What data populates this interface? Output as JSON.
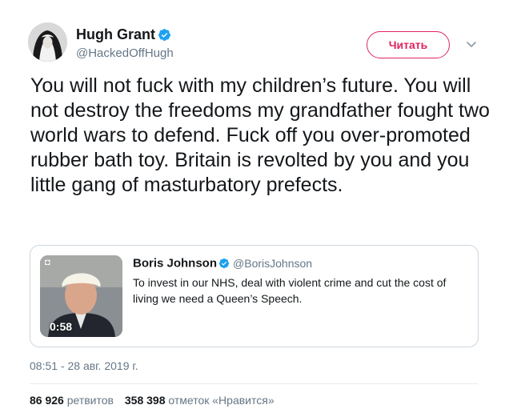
{
  "author": {
    "display_name": "Hugh Grant",
    "handle": "@HackedOffHugh"
  },
  "follow_button": {
    "label": "Читать"
  },
  "tweet": {
    "text": "You will not fuck with my children’s future. You will not destroy the freedoms my grandfather fought two world wars to defend. Fuck off you over-promoted rubber bath toy. Britain is revolted by you and you little gang of masturbatory prefects."
  },
  "quoted_tweet": {
    "display_name": "Boris Johnson",
    "handle": "@BorisJohnson",
    "text": "To invest in our NHS, deal with violent crime and cut the cost of living we need a Queen’s Speech.",
    "video_duration": "0:58"
  },
  "timestamp": "08:51 - 28 авг. 2019 г.",
  "stats": {
    "retweets_count": "86 926",
    "retweets_label": "ретвитов",
    "likes_count": "358 398",
    "likes_label": "отметок «Нравится»"
  },
  "colors": {
    "verified": "#1da1f2",
    "follow_accent": "#e0245e",
    "secondary_text": "#657786"
  },
  "icons": {
    "verified": "verified-badge-icon",
    "caret": "chevron-down-icon",
    "media": "video-icon"
  }
}
